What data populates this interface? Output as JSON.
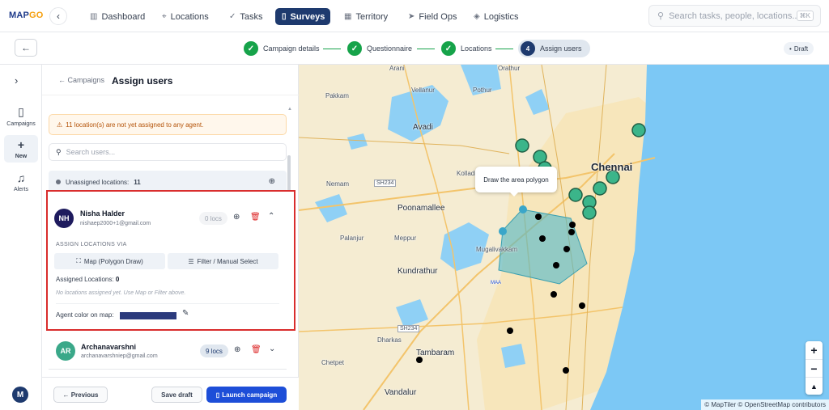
{
  "app": {
    "logo_main": "MAP",
    "logo_accent": "GO"
  },
  "nav": {
    "items": [
      {
        "label": "Dashboard",
        "icon": "bar-chart-icon"
      },
      {
        "label": "Locations",
        "icon": "pin-icon"
      },
      {
        "label": "Tasks",
        "icon": "check-icon"
      },
      {
        "label": "Surveys",
        "icon": "clipboard-icon",
        "active": true
      },
      {
        "label": "Territory",
        "icon": "map-icon"
      },
      {
        "label": "Field Ops",
        "icon": "send-icon"
      },
      {
        "label": "Logistics",
        "icon": "box-icon"
      }
    ],
    "search_placeholder": "Search tasks, people, locations...",
    "search_shortcut": "⌘K"
  },
  "stepper": {
    "steps": [
      {
        "label": "Campaign details",
        "state": "done"
      },
      {
        "label": "Questionnaire",
        "state": "done"
      },
      {
        "label": "Locations",
        "state": "done"
      },
      {
        "label": "Assign users",
        "state": "current",
        "number": "4"
      }
    ],
    "status_badge": "Draft"
  },
  "rail": {
    "items": [
      {
        "label": "Campaigns",
        "icon": "clipboard-icon"
      },
      {
        "label": "New",
        "icon": "plus-icon",
        "active": true
      },
      {
        "label": "Alerts",
        "icon": "bell-icon"
      }
    ],
    "user_initial": "M"
  },
  "panel": {
    "breadcrumb": "← Campaigns",
    "title": "Assign users",
    "warning": "11 location(s) are not yet assigned to any agent.",
    "search_placeholder": "Search users...",
    "unassigned_label": "Unassigned locations:",
    "unassigned_count": "11",
    "users": [
      {
        "initials": "NH",
        "name": "Nisha Halder",
        "email": "nishaep2000+1@gmail.com",
        "locs": "0 locs",
        "avatar_color": "#1e1b5e",
        "expanded": true,
        "assign_via_label": "ASSIGN LOCATIONS VIA",
        "map_button": "Map (Polygon Draw)",
        "filter_button": "Filter / Manual Select",
        "assigned_label": "Assigned Locations:",
        "assigned_count": "0",
        "empty_message": "No locations assigned yet. Use Map or Filter above.",
        "color_label": "Agent color on map:",
        "agent_color": "#2b3a7c"
      },
      {
        "initials": "AR",
        "name": "Archanavarshni",
        "email": "archanavarshniep@gmail.com",
        "locs": "9 locs",
        "avatar_color": "#3aa889",
        "expanded": false
      }
    ],
    "footer": {
      "previous": "← Previous",
      "save_draft": "Save draft",
      "launch": "Launch campaign"
    }
  },
  "map": {
    "tooltip": "Draw the area polygon",
    "labels": {
      "arani": "Arani",
      "orathur": "Orathur",
      "pakkam": "Pakkam",
      "vellanur": "Vellanur",
      "pothur": "Pothur",
      "avadi": "Avadi",
      "kolladi": "Kolladi",
      "chennai": "Chennai",
      "nemam": "Nemam",
      "sh234_top": "SH234",
      "poonamallee": "Poonamallee",
      "palanjur": "Palanjur",
      "mepur": "Meppur",
      "mugalivakkam": "Mugalivakkam",
      "kundrathur": "Kundrathur",
      "maa": "MAA",
      "sh234_bottom": "SH234",
      "dharkas": "Dharkas",
      "tambaram": "Tambaram",
      "chetpet": "Chetpet",
      "vandalur": "Vandalur"
    },
    "zoom_in": "+",
    "zoom_out": "−",
    "compass": "▲",
    "attribution": "© MapTiler © OpenStreetMap contributors",
    "colors": {
      "assigned_marker": "#3bb58a",
      "unassigned_marker": "#000000",
      "polygon_fill": "#4fb8c9",
      "water": "#8fd0f5",
      "sea": "#7cc8f5"
    }
  }
}
